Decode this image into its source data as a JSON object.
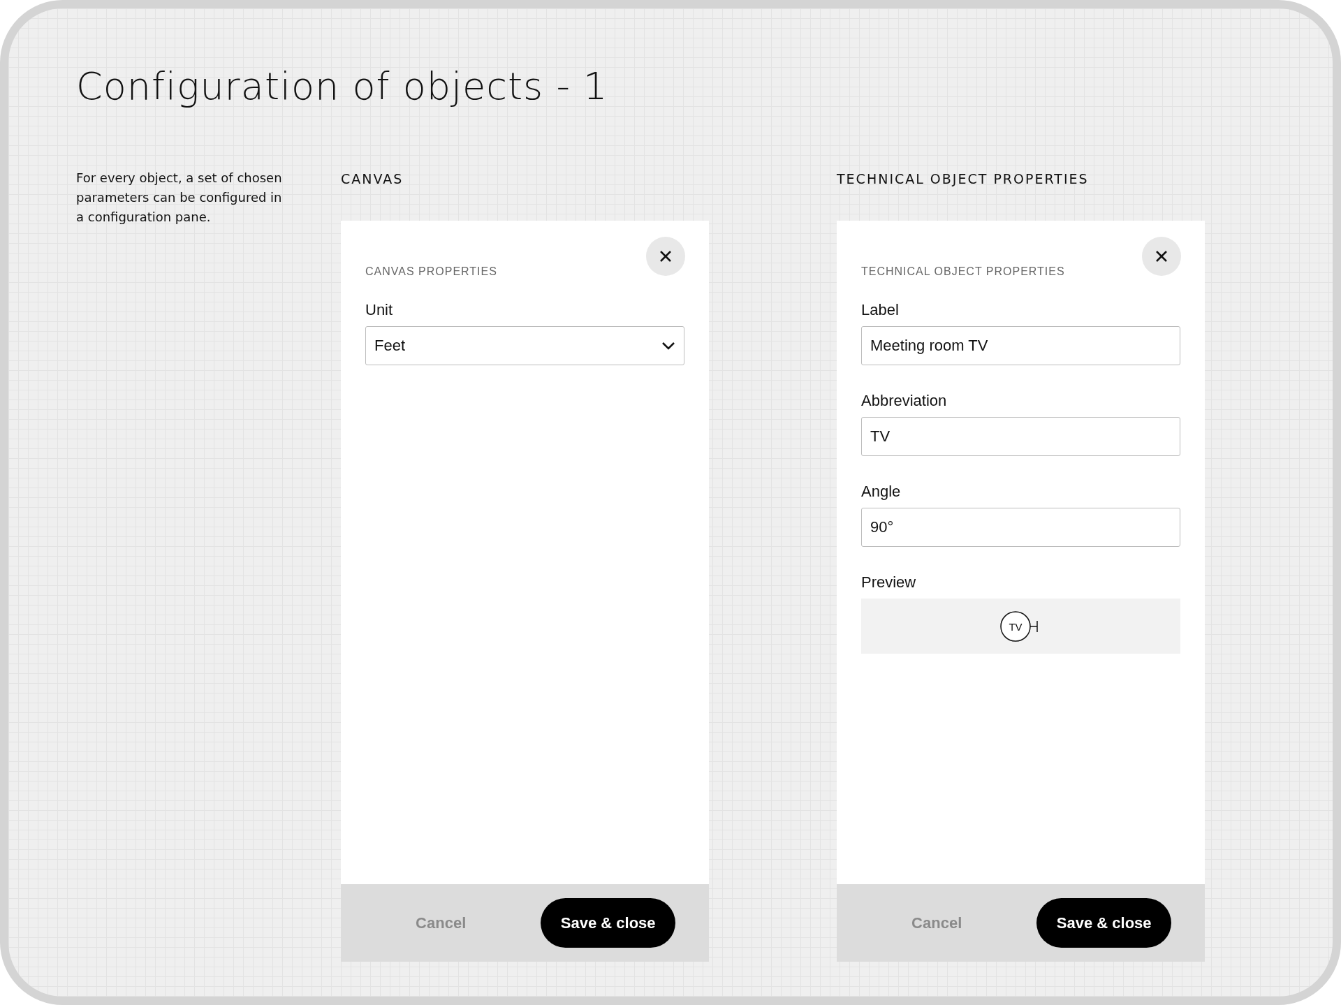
{
  "title": "Configuration of objects - 1",
  "description": "For every object, a set of chosen parameters can be configured in a configuration pane.",
  "panels": [
    {
      "heading": "CANVAS",
      "section_title": "CANVAS PROPERTIES",
      "fields": [
        {
          "kind": "select",
          "label": "Unit",
          "value": "Feet"
        }
      ],
      "footer": {
        "cancel": "Cancel",
        "save": "Save & close"
      }
    },
    {
      "heading": "TECHNICAL OBJECT PROPERTIES",
      "section_title": "TECHNICAL OBJECT PROPERTIES",
      "fields": [
        {
          "kind": "text",
          "label": "Label",
          "value": "Meeting room TV"
        },
        {
          "kind": "text",
          "label": "Abbreviation",
          "value": "TV"
        },
        {
          "kind": "text",
          "label": "Angle",
          "value": "90°"
        },
        {
          "kind": "preview",
          "label": "Preview",
          "symbol": "TV"
        }
      ],
      "footer": {
        "cancel": "Cancel",
        "save": "Save & close"
      }
    }
  ]
}
